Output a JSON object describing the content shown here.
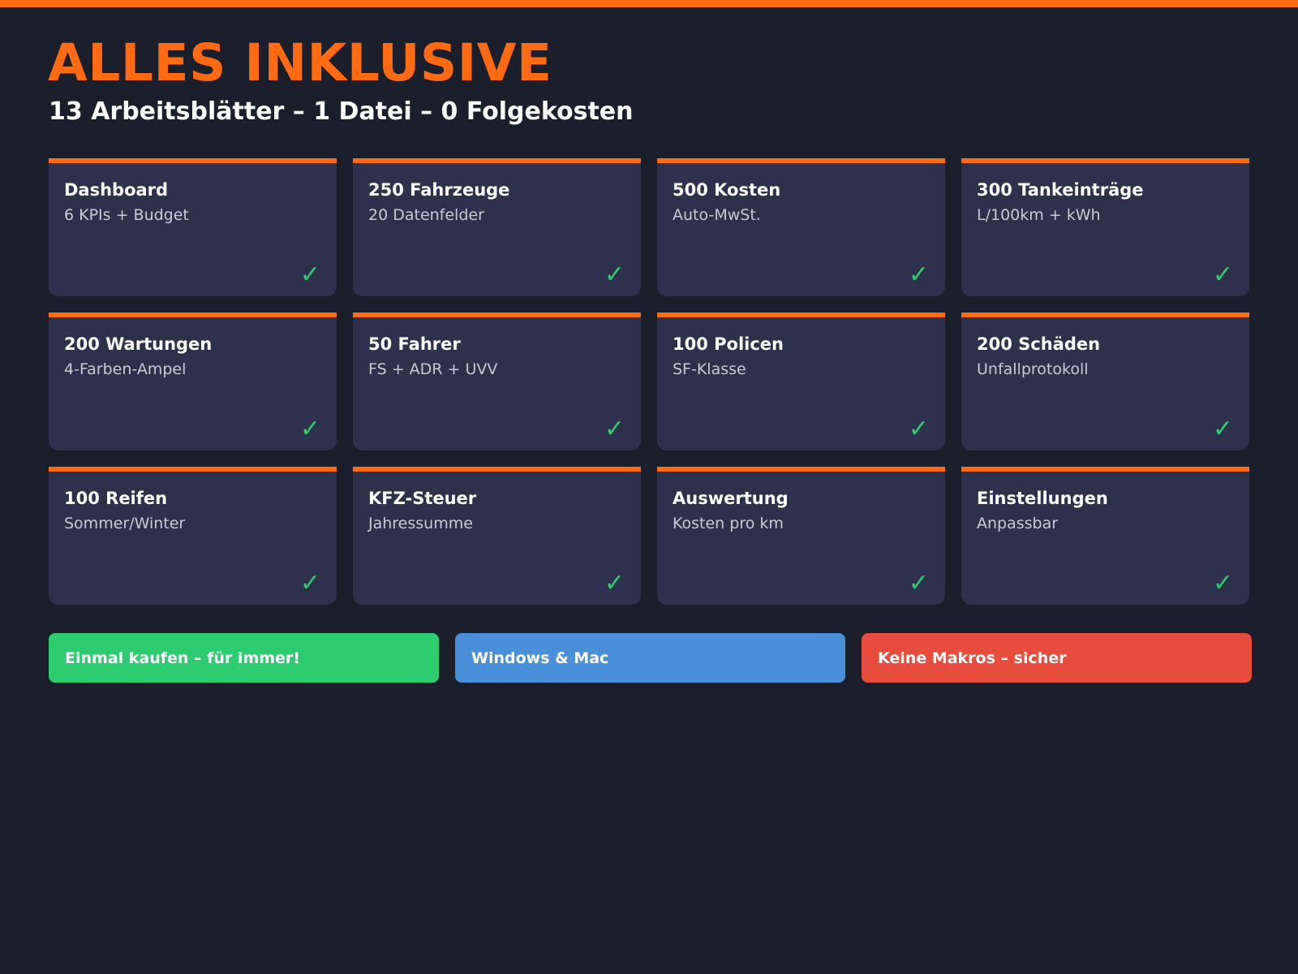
{
  "header": {
    "title": "ALLES INKLUSIVE",
    "subtitle": "13 Arbeitsblätter – 1 Datei – 0 Folgekosten"
  },
  "colors": {
    "accent": "#ff6a13",
    "background": "#1b1f2b",
    "card": "#2d314b",
    "check": "#2ecc71"
  },
  "cards": [
    {
      "title": "Dashboard",
      "desc": "6 KPIs + Budget",
      "check": "✓"
    },
    {
      "title": "250 Fahrzeuge",
      "desc": "20 Datenfelder",
      "check": "✓"
    },
    {
      "title": "500 Kosten",
      "desc": "Auto-MwSt.",
      "check": "✓"
    },
    {
      "title": "300 Tankeinträge",
      "desc": "L/100km + kWh",
      "check": "✓"
    },
    {
      "title": "200 Wartungen",
      "desc": "4-Farben-Ampel",
      "check": "✓"
    },
    {
      "title": "50 Fahrer",
      "desc": "FS + ADR + UVV",
      "check": "✓"
    },
    {
      "title": "100 Policen",
      "desc": "SF-Klasse",
      "check": "✓"
    },
    {
      "title": "200 Schäden",
      "desc": "Unfallprotokoll",
      "check": "✓"
    },
    {
      "title": "100 Reifen",
      "desc": "Sommer/Winter",
      "check": "✓"
    },
    {
      "title": "KFZ-Steuer",
      "desc": "Jahressumme",
      "check": "✓"
    },
    {
      "title": "Auswertung",
      "desc": "Kosten pro km",
      "check": "✓"
    },
    {
      "title": "Einstellungen",
      "desc": "Anpassbar",
      "check": "✓"
    }
  ],
  "badges": [
    {
      "label": "Einmal kaufen – für immer!",
      "color": "#2ecc71"
    },
    {
      "label": "Windows & Mac",
      "color": "#4a8fd9"
    },
    {
      "label": "Keine Makros – sicher",
      "color": "#e74c3c"
    }
  ]
}
